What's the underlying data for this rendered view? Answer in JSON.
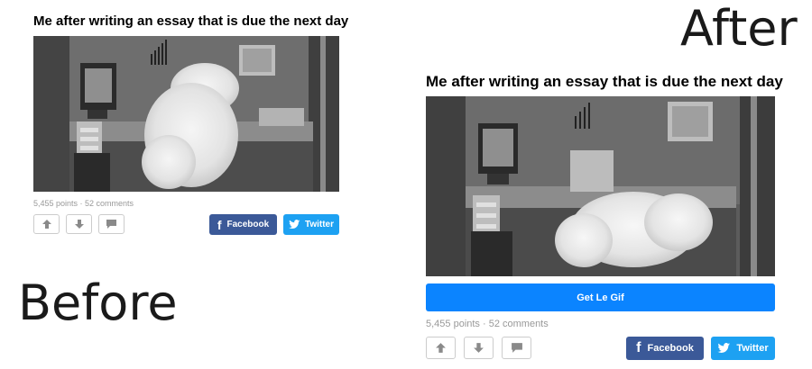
{
  "labels": {
    "after": "After",
    "before": "Before"
  },
  "post": {
    "title": "Me after writing an essay that is due the next day",
    "stats": "5,455 points · 52 comments",
    "upvote_icon": "arrow-up-icon",
    "downvote_icon": "arrow-down-icon",
    "comment_icon": "comment-bubble-icon",
    "facebook_label": "Facebook",
    "twitter_label": "Twitter",
    "facebook_icon": "facebook-f-icon",
    "twitter_icon": "twitter-bird-icon",
    "gif_button_label": "Get Le Gif"
  },
  "colors": {
    "facebook": "#3b5998",
    "twitter": "#1da1f2",
    "gif_button": "#0b84ff",
    "stats_text": "#999999"
  }
}
